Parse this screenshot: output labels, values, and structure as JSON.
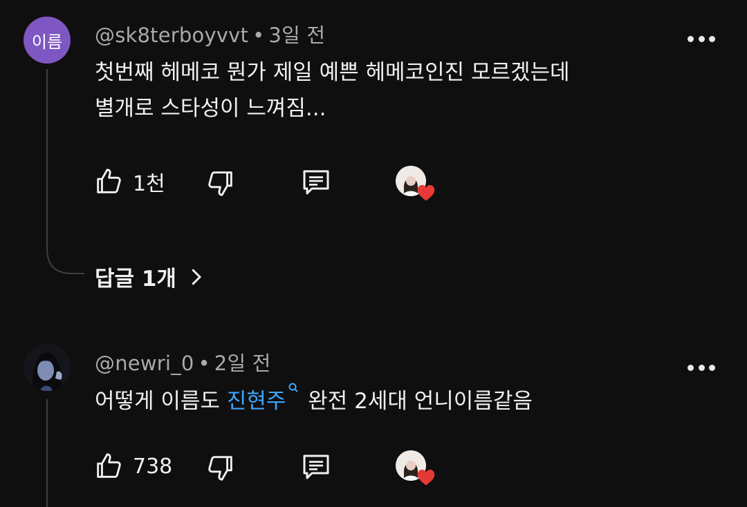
{
  "comments": [
    {
      "avatar_text": "이름",
      "handle": "@sk8terboyvvt",
      "time": "3일 전",
      "lines": [
        "첫번째 헤메코 뭔가 제일 예쁜 헤메코인진 모르겠는데",
        "별개로 스타성이 느껴짐..."
      ],
      "likes": "1천",
      "replies_label": "답글 1개"
    },
    {
      "handle": "@newri_0",
      "time": "2일 전",
      "text_before": "어떻게 이름도 ",
      "link_text": "진현주",
      "text_after": " 완전 2세대 언니이름같음",
      "likes": "738"
    }
  ],
  "separator": "•",
  "colors": {
    "background": "#0f0f0f",
    "link": "#3ea6ff",
    "avatar": "#7e57c2",
    "heart": "#e53935"
  },
  "icons": [
    "like-icon",
    "dislike-icon",
    "reply-icon",
    "heart-icon",
    "more-icon",
    "search-icon",
    "chevron-right-icon"
  ]
}
